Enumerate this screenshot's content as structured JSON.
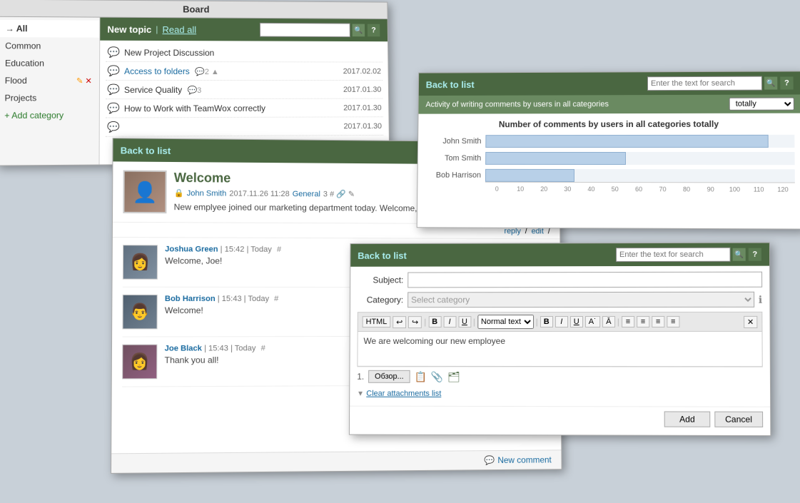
{
  "app": {
    "title": "Board"
  },
  "sidebar": {
    "items": [
      {
        "id": "all",
        "label": "→ All",
        "active": true
      },
      {
        "id": "common",
        "label": "Common"
      },
      {
        "id": "education",
        "label": "Education"
      },
      {
        "id": "flood",
        "label": "Flood"
      },
      {
        "id": "projects",
        "label": "Projects"
      }
    ],
    "add_label": "+ Add category",
    "flood_edit_icon": "✎",
    "flood_delete_icon": "✕"
  },
  "board": {
    "new_topic_label": "New topic",
    "sep": "|",
    "read_all_label": "Read all",
    "search_placeholder": "",
    "search_btn": "🔍",
    "help_btn": "?",
    "topics": [
      {
        "icon": "💬",
        "title": "New Project Discussion",
        "date": "",
        "link": false,
        "meta": ""
      },
      {
        "date": "2017.02.02",
        "icon": "💬",
        "title": "Access to folders",
        "link": true,
        "meta": "2 ▲"
      },
      {
        "date": "2017.01.30",
        "icon": "💬",
        "title": "Service Quality",
        "link": false,
        "meta": "3"
      },
      {
        "date": "2017.01.30",
        "icon": "💬",
        "title": "How to Work with TeamWox correctly",
        "link": false,
        "meta": ""
      },
      {
        "date": "2017.01.30",
        "icon": "💬",
        "title": "",
        "link": false,
        "meta": ""
      }
    ]
  },
  "post": {
    "back_label": "Back to list",
    "title": "Welcome",
    "author": "John Smith",
    "date": "2017.11.26 11:28",
    "category": "General",
    "meta_icons": "3 # 🔗 ✎",
    "body": "New emplyee joined our marketing department today. Welcome, Joe Black!",
    "actions": {
      "reply": "reply",
      "edit": "edit",
      "sep": "/"
    },
    "comments": [
      {
        "author": "Joshua Green",
        "time": "15:42",
        "day": "Today",
        "hash": "#",
        "text": "Welcome, Joe!"
      },
      {
        "author": "Bob Harrison",
        "time": "15:43",
        "day": "Today",
        "hash": "#",
        "text": "Welcome!"
      },
      {
        "author": "Joe Black",
        "time": "15:43",
        "day": "Today",
        "hash": "#",
        "text": "Thank you all!"
      }
    ],
    "new_comment_label": "New comment",
    "search_placeholder": ""
  },
  "chart": {
    "back_label": "Back to list",
    "subheader_text": "Activity of writing comments by users in all categories",
    "filter_value": "totally",
    "title": "Number of comments by users in all categories totally",
    "users": [
      {
        "name": "John Smith",
        "value": 110,
        "max": 120
      },
      {
        "name": "Tom Smith",
        "value": 55,
        "max": 120
      },
      {
        "name": "Bob Harrison",
        "value": 35,
        "max": 120
      }
    ],
    "axis_labels": [
      "0",
      "10",
      "20",
      "30",
      "40",
      "50",
      "60",
      "70",
      "80",
      "90",
      "100",
      "110",
      "120"
    ],
    "search_placeholder": "Enter the text for search",
    "search_btn": "🔍",
    "help_btn": "?"
  },
  "form": {
    "back_label": "Back to list",
    "subject_label": "Subject:",
    "category_label": "Category:",
    "category_placeholder": "Select category",
    "editor_content": "We are welcoming our new employee",
    "html_btn": "HTML",
    "attach_num": "1.",
    "browse_btn": "Обзор...",
    "clear_attachments": "Clear attachments list",
    "add_btn": "Add",
    "cancel_btn": "Cancel",
    "search_placeholder": "Enter the text for search",
    "help_btn": "?",
    "toolbar": {
      "buttons": [
        "HTML",
        "↩",
        "↪",
        "B",
        "I",
        "U",
        "A",
        "Normal text",
        "B",
        "I",
        "U",
        "A˙",
        "A̲",
        "≡",
        "≡",
        "≡",
        "≡",
        "✕"
      ]
    }
  }
}
